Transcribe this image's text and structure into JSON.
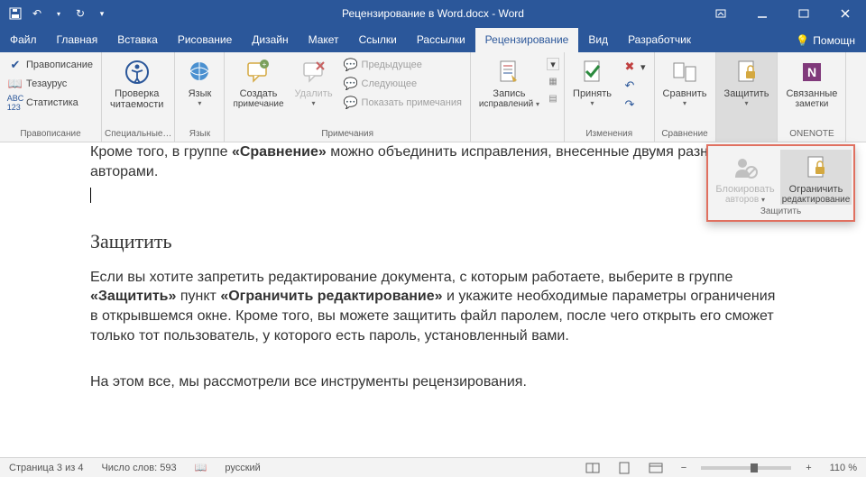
{
  "title": "Рецензирование в Word.docx  -  Word",
  "tabs": [
    "Файл",
    "Главная",
    "Вставка",
    "Рисование",
    "Дизайн",
    "Макет",
    "Ссылки",
    "Рассылки",
    "Рецензирование",
    "Вид",
    "Разработчик"
  ],
  "active_tab": 8,
  "help": "Помощн",
  "ribbon": {
    "g1": {
      "spell": "Правописание",
      "thes": "Тезаурус",
      "stat": "Статистика",
      "label": "Правописание"
    },
    "g2": {
      "btn": "Проверка",
      "btn2": "читаемости",
      "label": "Специальные…"
    },
    "g3": {
      "btn": "Язык",
      "label": "Язык"
    },
    "g4": {
      "create": "Создать",
      "create2": "примечание",
      "del": "Удалить",
      "prev": "Предыдущее",
      "next": "Следующее",
      "show": "Показать примечания",
      "label": "Примечания"
    },
    "g5": {
      "btn": "Запись",
      "btn2": "исправлений",
      "label": "",
      "group_label": ""
    },
    "g6": {
      "accept": "Принять",
      "group_label": "Изменения"
    },
    "g7": {
      "compare": "Сравнить",
      "group_label": "Сравнение"
    },
    "g8": {
      "protect": "Защитить"
    },
    "g9": {
      "linked": "Связанные",
      "linked2": "заметки",
      "group_label": "ONENOTE"
    }
  },
  "popup": {
    "block": "Блокировать",
    "block2": "авторов",
    "restrict": "Ограничить",
    "restrict2": "редактирование",
    "label": "Защитить"
  },
  "doc": {
    "p1a": "Кроме того, в группе ",
    "p1b": "«Сравнение»",
    "p1c": " можно объединить исправления, внесенные двумя разными авторами.",
    "h": "Защитить",
    "p2a": "Если вы хотите запретить редактирование документа, с которым работаете, выберите в группе ",
    "p2b": "«Защитить»",
    "p2c": " пункт ",
    "p2d": "«Ограничить редактирование»",
    "p2e": " и укажите необходимые параметры ограничения в открывшемся окне. Кроме того, вы можете защитить файл паролем, после чего открыть его сможет только тот пользователь, у которого есть пароль, установленный вами.",
    "p3": "На этом все, мы рассмотрели все инструменты рецензирования."
  },
  "status": {
    "page": "Страница 3 из 4",
    "words": "Число слов: 593",
    "lang": "русский",
    "zoom": "110 %",
    "minus": "−",
    "plus": "+"
  }
}
